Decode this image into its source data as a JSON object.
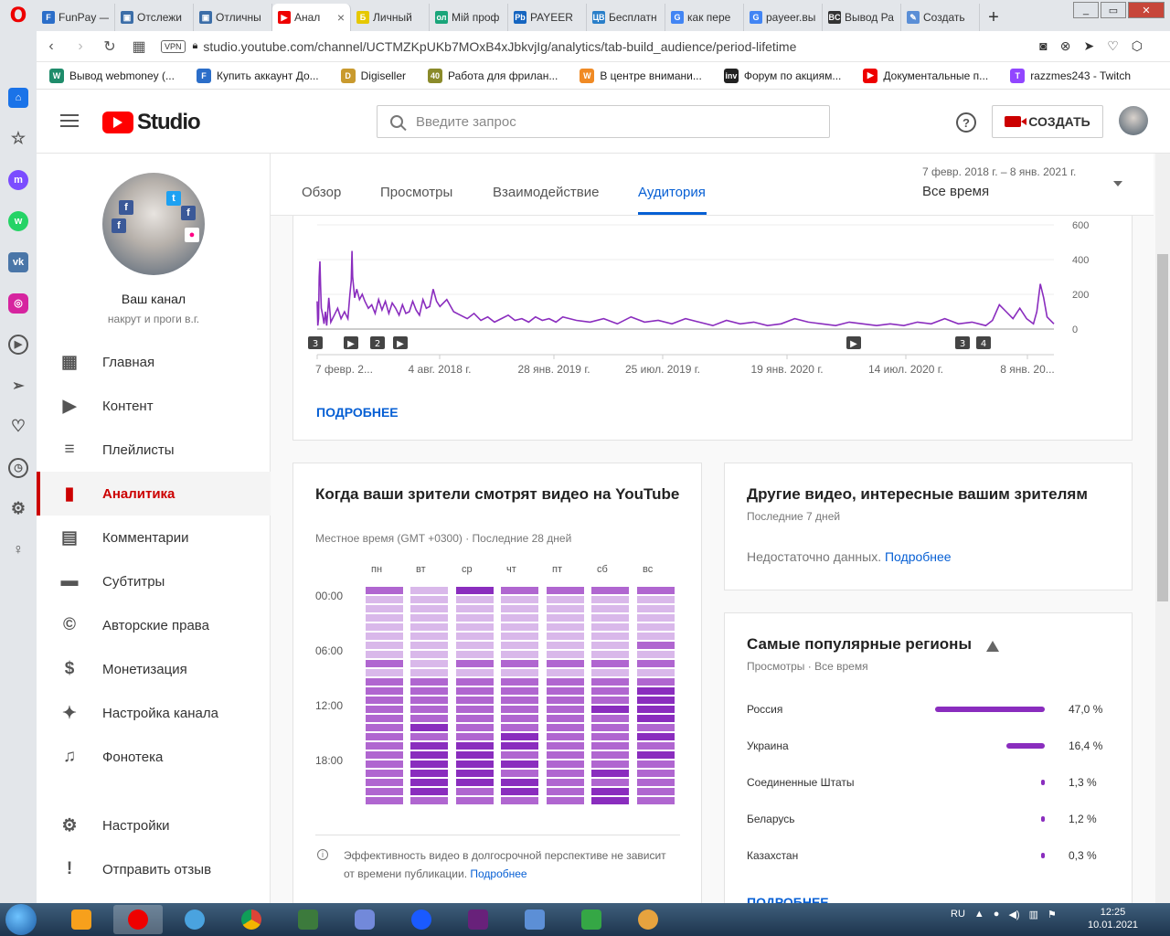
{
  "browser": {
    "tabs": [
      {
        "label": "FunPay — ",
        "color": "#2b6ec9",
        "glyph": "F"
      },
      {
        "label": "Отслежи",
        "color": "#3c6ea8",
        "glyph": "▣"
      },
      {
        "label": "Отличны",
        "color": "#3c6ea8",
        "glyph": "▣"
      },
      {
        "label": "Анал",
        "color": "#e00",
        "glyph": "▶",
        "active": true
      },
      {
        "label": "Личный",
        "color": "#e6c800",
        "glyph": "Б"
      },
      {
        "label": "Мій проф",
        "color": "#1aa57a",
        "glyph": "ол"
      },
      {
        "label": "PAYEER",
        "color": "#1565c0",
        "glyph": "Pb"
      },
      {
        "label": "Бесплатн",
        "color": "#2a7fc9",
        "glyph": "ЦВ"
      },
      {
        "label": "как пере",
        "color": "#4285f4",
        "glyph": "G"
      },
      {
        "label": "payeer.вы",
        "color": "#4285f4",
        "glyph": "G"
      },
      {
        "label": "Вывод Ра",
        "color": "#333",
        "glyph": "BC"
      },
      {
        "label": "Создать",
        "color": "#5a8ed6",
        "glyph": "✎"
      }
    ],
    "url": "studio.youtube.com/channel/UCTMZKpUKb7MOxB4xJbkvjIg/analytics/tab-build_audience/period-lifetime",
    "vpn_label": "VPN",
    "bookmarks": [
      {
        "label": "Вывод webmoney (...",
        "color": "#1f8c6b",
        "glyph": "W"
      },
      {
        "label": "Купить аккаунт До...",
        "color": "#2b6ec9",
        "glyph": "F"
      },
      {
        "label": "Digiseller",
        "color": "#c99a2e",
        "glyph": "D"
      },
      {
        "label": "Работа для фрилан...",
        "color": "#8a8a2a",
        "glyph": "40"
      },
      {
        "label": "В центре внимани...",
        "color": "#f08a24",
        "glyph": "W"
      },
      {
        "label": "Форум по акциям...",
        "color": "#222",
        "glyph": "inv"
      },
      {
        "label": "Документальные п...",
        "color": "#e00",
        "glyph": "▶"
      },
      {
        "label": "razzmes243 - Twitch",
        "color": "#9146ff",
        "glyph": "T"
      }
    ]
  },
  "header": {
    "logo_text": "Studio",
    "search_placeholder": "Введите запрос",
    "help_glyph": "?",
    "create_label": "СОЗДАТЬ"
  },
  "channel": {
    "name": "Ваш канал",
    "description": "накрут и проги в.г."
  },
  "nav": [
    {
      "id": "home",
      "label": "Главная"
    },
    {
      "id": "content",
      "label": "Контент"
    },
    {
      "id": "playlists",
      "label": "Плейлисты"
    },
    {
      "id": "analytics",
      "label": "Аналитика",
      "active": true
    },
    {
      "id": "comments",
      "label": "Комментарии"
    },
    {
      "id": "subtitles",
      "label": "Субтитры"
    },
    {
      "id": "copyright",
      "label": "Авторские права"
    },
    {
      "id": "monetization",
      "label": "Монетизация"
    },
    {
      "id": "customization",
      "label": "Настройка канала"
    },
    {
      "id": "audio",
      "label": "Фонотека"
    },
    {
      "id": "settings",
      "label": "Настройки"
    },
    {
      "id": "feedback",
      "label": "Отправить отзыв"
    }
  ],
  "analytics_tabs": [
    {
      "label": "Обзор"
    },
    {
      "label": "Просмотры"
    },
    {
      "label": "Взаимодействие"
    },
    {
      "label": "Аудитория",
      "active": true
    }
  ],
  "period": {
    "range": "7 февр. 2018 г. – 8 янв. 2021 г.",
    "value": "Все время"
  },
  "chart_data": {
    "type": "line",
    "ylim": [
      0,
      600
    ],
    "y_ticks": [
      "600",
      "400",
      "200",
      "0"
    ],
    "x_tick_labels": [
      "7 февр. 2...",
      "4 авг. 2018 г.",
      "28 янв. 2019 г.",
      "25 июл. 2019 г.",
      "19 янв. 2020 г.",
      "14 июл. 2020 г.",
      "8 янв. 20..."
    ],
    "series_color": "#8a2dbe",
    "x_days": [
      0,
      1,
      2,
      3,
      4,
      5,
      6,
      8,
      10,
      12,
      14,
      17,
      20,
      25,
      30,
      35,
      40,
      45,
      48,
      50,
      51,
      52,
      55,
      58,
      62,
      66,
      70,
      75,
      80,
      85,
      90,
      95,
      100,
      105,
      110,
      115,
      120,
      125,
      130,
      135,
      140,
      145,
      150,
      155,
      160,
      165,
      170,
      175,
      180,
      190,
      200,
      210,
      220,
      230,
      240,
      250,
      260,
      270,
      280,
      290,
      300,
      310,
      320,
      330,
      340,
      350,
      360,
      380,
      400,
      420,
      440,
      460,
      480,
      500,
      520,
      540,
      560,
      580,
      600,
      620,
      640,
      660,
      680,
      700,
      720,
      740,
      760,
      780,
      800,
      820,
      840,
      860,
      880,
      900,
      920,
      940,
      960,
      980,
      990,
      1000,
      1010,
      1020,
      1030,
      1040,
      1050,
      1055,
      1060,
      1065,
      1070,
      1080
    ],
    "values": [
      160,
      20,
      60,
      300,
      390,
      250,
      120,
      80,
      30,
      100,
      20,
      180,
      40,
      80,
      120,
      60,
      100,
      60,
      200,
      280,
      450,
      300,
      180,
      230,
      170,
      200,
      160,
      120,
      140,
      90,
      170,
      110,
      160,
      90,
      150,
      120,
      80,
      140,
      90,
      100,
      160,
      110,
      80,
      170,
      120,
      130,
      230,
      160,
      130,
      170,
      100,
      80,
      60,
      90,
      50,
      70,
      40,
      60,
      80,
      50,
      60,
      40,
      70,
      50,
      60,
      40,
      70,
      50,
      40,
      60,
      30,
      70,
      40,
      50,
      30,
      60,
      40,
      20,
      50,
      30,
      40,
      20,
      30,
      60,
      40,
      30,
      20,
      40,
      30,
      20,
      30,
      20,
      40,
      30,
      60,
      30,
      40,
      20,
      50,
      140,
      100,
      60,
      120,
      60,
      30,
      100,
      260,
      180,
      70,
      30
    ]
  },
  "video_markers": [
    "3",
    "▶",
    "2",
    "▶",
    "▶",
    "3",
    "4"
  ],
  "chart_more": "ПОДРОБНЕЕ",
  "watch_time": {
    "title": "Когда ваши зрители смотрят видео на YouTube",
    "subtitle": "Местное время (GMT +0300) · Последние 28 дней",
    "days": [
      "пн",
      "вт",
      "ср",
      "чт",
      "пт",
      "сб",
      "вс"
    ],
    "times": [
      "00:00",
      "06:00",
      "12:00",
      "18:00"
    ],
    "note": "Эффективность видео в долгосрочной перспективе не зависит от времени публикации.",
    "note_link": "Подробнее",
    "intensity": [
      [
        2,
        1,
        3,
        2,
        2,
        2,
        2
      ],
      [
        1,
        1,
        1,
        1,
        1,
        1,
        1
      ],
      [
        1,
        1,
        1,
        1,
        1,
        1,
        1
      ],
      [
        1,
        1,
        1,
        1,
        1,
        1,
        1
      ],
      [
        1,
        1,
        1,
        1,
        1,
        1,
        1
      ],
      [
        1,
        1,
        1,
        1,
        1,
        1,
        1
      ],
      [
        1,
        1,
        1,
        1,
        1,
        1,
        2
      ],
      [
        1,
        1,
        1,
        1,
        1,
        1,
        1
      ],
      [
        2,
        1,
        2,
        2,
        2,
        2,
        2
      ],
      [
        1,
        1,
        1,
        1,
        1,
        1,
        1
      ],
      [
        2,
        2,
        2,
        2,
        2,
        2,
        2
      ],
      [
        2,
        2,
        2,
        2,
        2,
        2,
        3
      ],
      [
        2,
        2,
        2,
        2,
        2,
        2,
        3
      ],
      [
        2,
        2,
        2,
        2,
        2,
        3,
        3
      ],
      [
        2,
        2,
        2,
        2,
        2,
        2,
        3
      ],
      [
        2,
        3,
        2,
        2,
        2,
        2,
        2
      ],
      [
        2,
        2,
        2,
        3,
        2,
        2,
        3
      ],
      [
        2,
        3,
        3,
        3,
        2,
        2,
        2
      ],
      [
        2,
        3,
        3,
        2,
        2,
        2,
        3
      ],
      [
        2,
        3,
        3,
        3,
        2,
        2,
        2
      ],
      [
        2,
        3,
        3,
        2,
        2,
        3,
        2
      ],
      [
        2,
        3,
        3,
        3,
        2,
        2,
        2
      ],
      [
        2,
        3,
        2,
        3,
        2,
        3,
        2
      ],
      [
        2,
        2,
        2,
        2,
        2,
        3,
        2
      ]
    ]
  },
  "other_videos": {
    "title": "Другие видео, интересные вашим зрителям",
    "subtitle": "Последние 7 дней",
    "empty": "Недостаточно данных.",
    "link": "Подробнее"
  },
  "regions": {
    "title": "Самые популярные регионы",
    "subtitle": "Просмотры · Все время",
    "more": "ПОДРОБНЕЕ",
    "items": [
      {
        "name": "Россия",
        "share": 47.0,
        "label": "47,0 %"
      },
      {
        "name": "Украина",
        "share": 16.4,
        "label": "16,4 %"
      },
      {
        "name": "Соединенные Штаты",
        "share": 1.3,
        "label": "1,3 %"
      },
      {
        "name": "Беларусь",
        "share": 1.2,
        "label": "1,2 %"
      },
      {
        "name": "Казахстан",
        "share": 0.3,
        "label": "0,3 %"
      }
    ]
  },
  "taskbar": {
    "lang": "RU",
    "time": "12:25",
    "date": "10.01.2021"
  }
}
